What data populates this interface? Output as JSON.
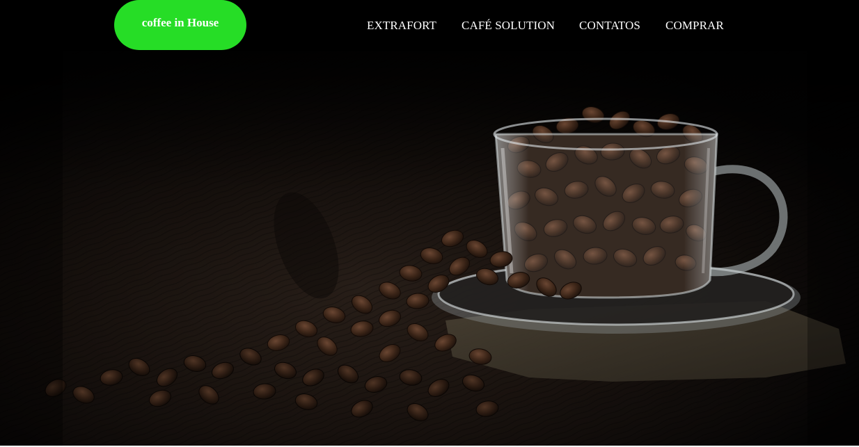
{
  "brand": {
    "logo_text": "coffee in House",
    "accent_color": "#26dd26"
  },
  "nav": {
    "items": [
      {
        "label": "EXTRAFORT"
      },
      {
        "label": "CAFÉ SOLUTION"
      },
      {
        "label": "CONTATOS"
      },
      {
        "label": "COMPRAR"
      }
    ]
  },
  "hero": {
    "image": "coffee-cup-beans-photo"
  }
}
